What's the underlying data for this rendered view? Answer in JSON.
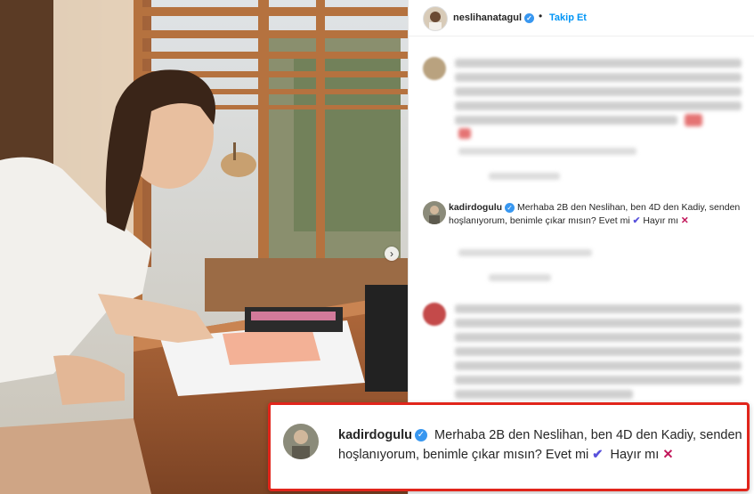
{
  "post": {
    "username": "neslihanatagul",
    "follow_label": "Takip Et",
    "dot": "•",
    "carousel_next": "›"
  },
  "icons": {
    "verified": "✓",
    "check": "✔",
    "cross": "✕"
  },
  "highlight_comment": {
    "username": "kadirdogulu",
    "text_before": "Merhaba 2B den Neslihan, ben 4D den Kadiy, senden hoşlanıyorum, benimle çıkar mısın? Evet mi",
    "text_middle": "Hayır mı"
  },
  "zoom_comment": {
    "username": "kadirdogulu",
    "text_before": "Merhaba 2B den Neslihan, ben 4D den Kadiy, senden hoşlanıyorum, benimle çıkar mısın? Evet mi",
    "text_middle": "Hayır mı"
  },
  "colors": {
    "follow": "#0095f6",
    "verified": "#3897f0",
    "highlight_border": "#e1251b"
  }
}
